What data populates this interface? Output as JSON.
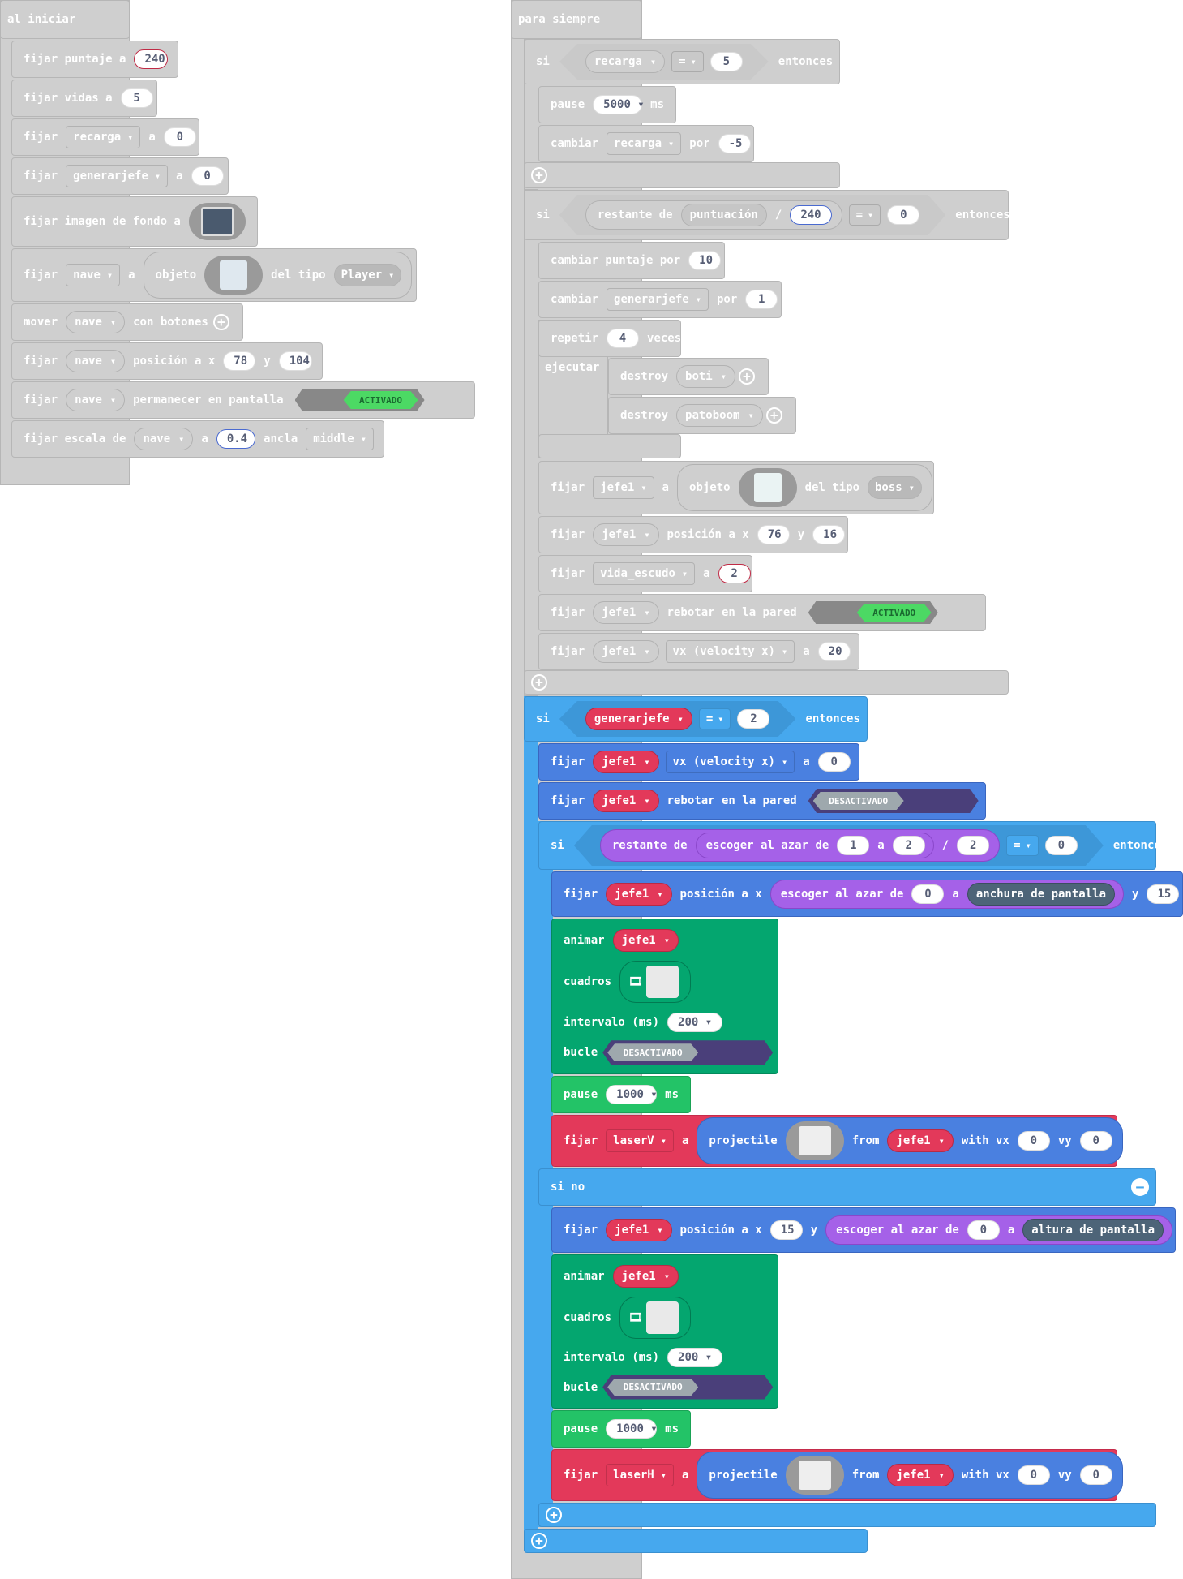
{
  "on_start": {
    "hat": "al iniciar",
    "set_score": {
      "label": "fijar puntaje a",
      "value": "240"
    },
    "set_lives": {
      "label": "fijar vidas a",
      "value": "5"
    },
    "set_recarga": {
      "fijar": "fijar",
      "var": "recarga",
      "a": "a",
      "value": "0"
    },
    "set_generarjefe": {
      "fijar": "fijar",
      "var": "generarjefe",
      "a": "a",
      "value": "0"
    },
    "set_bg": {
      "label": "fijar imagen de fondo a"
    },
    "set_nave": {
      "fijar": "fijar",
      "var": "nave",
      "a": "a",
      "objeto": "objeto",
      "del_tipo": "del tipo",
      "kind": "Player"
    },
    "move": {
      "label": "mover",
      "var": "nave",
      "suffix": "con botones"
    },
    "pos": {
      "fijar": "fijar",
      "var": "nave",
      "label": "posición a x",
      "x": "78",
      "y_label": "y",
      "y": "104"
    },
    "stay": {
      "fijar": "fijar",
      "var": "nave",
      "label": "permanecer en pantalla",
      "toggle": "ACTIVADO"
    },
    "scale": {
      "label": "fijar escala de",
      "var": "nave",
      "a": "a",
      "value": "0.4",
      "anchor_label": "ancla",
      "anchor": "middle"
    }
  },
  "forever": {
    "hat": "para siempre",
    "if1": {
      "si": "si",
      "var": "recarga",
      "op": "=",
      "value": "5",
      "then": "entonces"
    },
    "pause1": {
      "label": "pause",
      "value": "5000",
      "unit": "ms"
    },
    "change_recarga": {
      "label": "cambiar",
      "var": "recarga",
      "by": "por",
      "value": "-5"
    },
    "if2": {
      "si": "si",
      "restante": "restante de",
      "puntuacion": "puntuación",
      "div": "/",
      "divisor": "240",
      "op": "=",
      "value": "0",
      "then": "entonces"
    },
    "change_score": {
      "label": "cambiar puntaje por",
      "value": "10"
    },
    "change_gen": {
      "label": "cambiar",
      "var": "generarjefe",
      "by": "por",
      "value": "1"
    },
    "repeat": {
      "label": "repetir",
      "value": "4",
      "times": "veces",
      "do": "ejecutar"
    },
    "destroy1": {
      "label": "destroy",
      "var": "boti"
    },
    "destroy2": {
      "label": "destroy",
      "var": "patoboom"
    },
    "set_jefe": {
      "fijar": "fijar",
      "var": "jefe1",
      "a": "a",
      "objeto": "objeto",
      "del_tipo": "del tipo",
      "kind": "boss"
    },
    "jefe_pos": {
      "fijar": "fijar",
      "var": "jefe1",
      "label": "posición a x",
      "x": "76",
      "y_label": "y",
      "y": "16"
    },
    "vida_escudo": {
      "fijar": "fijar",
      "var": "vida_escudo",
      "a": "a",
      "value": "2"
    },
    "bounce_on": {
      "fijar": "fijar",
      "var": "jefe1",
      "label": "rebotar en la pared",
      "toggle": "ACTIVADO"
    },
    "vx20": {
      "fijar": "fijar",
      "var": "jefe1",
      "prop": "vx (velocity x)",
      "a": "a",
      "value": "20"
    },
    "if3": {
      "si": "si",
      "var": "generarjefe",
      "op": "=",
      "value": "2",
      "then": "entonces"
    },
    "vx0": {
      "fijar": "fijar",
      "var": "jefe1",
      "prop": "vx (velocity x)",
      "a": "a",
      "value": "0"
    },
    "bounce_off": {
      "fijar": "fijar",
      "var": "jefe1",
      "label": "rebotar en la pared",
      "toggle": "DESACTIVADO"
    },
    "if4": {
      "si": "si",
      "restante": "restante de",
      "random": "escoger al azar de",
      "from": "1",
      "a": "a",
      "to": "2",
      "div": "/",
      "divisor": "2",
      "op": "=",
      "value": "0",
      "then": "entonces"
    },
    "pos_a": {
      "fijar": "fijar",
      "var": "jefe1",
      "label": "posición a x",
      "random": "escoger al azar de",
      "from": "0",
      "a": "a",
      "dim": "anchura de pantalla",
      "y_label": "y",
      "y": "15"
    },
    "anim_a": {
      "animar": "animar",
      "var": "jefe1",
      "cuadros": "cuadros",
      "interval_label": "intervalo (ms)",
      "interval": "200",
      "loop": "bucle",
      "toggle": "DESACTIVADO"
    },
    "pause_a": {
      "label": "pause",
      "value": "1000",
      "unit": "ms"
    },
    "laser_a": {
      "fijar": "fijar",
      "var": "laserV",
      "a": "a",
      "projectile": "projectile",
      "from": "from",
      "src": "jefe1",
      "with_vx": "with vx",
      "vx": "0",
      "vy_label": "vy",
      "vy": "0"
    },
    "else": "si no",
    "pos_b": {
      "fijar": "fijar",
      "var": "jefe1",
      "label": "posición a x",
      "x": "15",
      "y_label": "y",
      "random": "escoger al azar de",
      "from": "0",
      "a": "a",
      "dim": "altura de pantalla"
    },
    "anim_b": {
      "animar": "animar",
      "var": "jefe1",
      "cuadros": "cuadros",
      "interval_label": "intervalo (ms)",
      "interval": "200",
      "loop": "bucle",
      "toggle": "DESACTIVADO"
    },
    "pause_b": {
      "label": "pause",
      "value": "1000",
      "unit": "ms"
    },
    "laser_b": {
      "fijar": "fijar",
      "var": "laserH",
      "a": "a",
      "projectile": "projectile",
      "from": "from",
      "src": "jefe1",
      "with_vx": "with vx",
      "vx": "0",
      "vy_label": "vy",
      "vy": "0"
    }
  },
  "colors": {
    "disabled": "#cfcfcf",
    "logic": "#46a8ee",
    "sprites": "#4a80e0",
    "animation": "#04a66f",
    "loops": "#23c367",
    "variable": "#e3395a",
    "math": "#a561e8"
  }
}
